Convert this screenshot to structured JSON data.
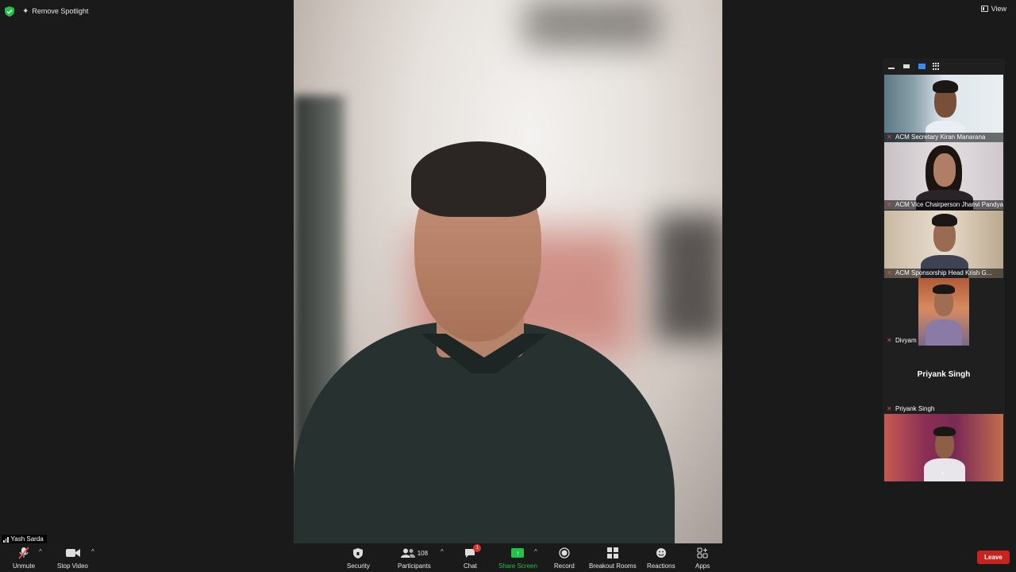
{
  "top_bar": {
    "spotlight_label": "Remove Spotlight",
    "view_label": "View"
  },
  "main_video": {
    "participant": "Yash Sarda"
  },
  "gallery": {
    "tiles": [
      {
        "name": "ACM Secretary Kiran Manarana",
        "muted": true,
        "video": true
      },
      {
        "name": "ACM Vice Chairperson Jhanvi Pandya",
        "muted": true,
        "video": true
      },
      {
        "name": "ACM Sponsorship Head Krish G...",
        "muted": true,
        "video": true
      },
      {
        "name": "Divyam",
        "muted": true,
        "video": true
      },
      {
        "name": "Priyank Singh",
        "display_name": "Priyank Singh",
        "muted": true,
        "video": false
      },
      {
        "name": "",
        "muted": false,
        "video": true
      }
    ]
  },
  "toolbar": {
    "self_name": "Yash Sarda",
    "unmute_label": "Unmute",
    "stop_video_label": "Stop Video",
    "security_label": "Security",
    "participants_label": "Participants",
    "participants_count": "108",
    "chat_label": "Chat",
    "chat_badge": "1",
    "share_label": "Share Screen",
    "record_label": "Record",
    "breakout_label": "Breakout Rooms",
    "reactions_label": "Reactions",
    "apps_label": "Apps",
    "leave_label": "Leave"
  },
  "colors": {
    "share_green": "#23c04b",
    "leave_red": "#c8241f",
    "muted_red": "#e74c4c",
    "active_blue": "#3a8bea"
  }
}
